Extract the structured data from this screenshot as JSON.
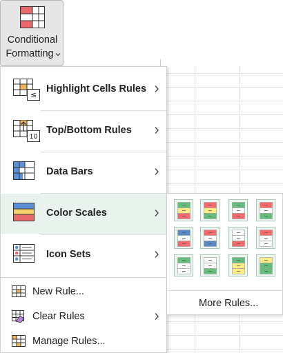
{
  "ribbon": {
    "cf_label_line1": "Conditional",
    "cf_label_line2": "Formatting"
  },
  "menu": {
    "items": [
      {
        "label": "Highlight Cells Rules",
        "icon": "highlight-cells-icon",
        "has_submenu": true
      },
      {
        "label": "Top/Bottom Rules",
        "icon": "top-bottom-icon",
        "icon_text": "10",
        "has_submenu": true
      },
      {
        "label": "Data Bars",
        "icon": "data-bars-icon",
        "has_submenu": true
      },
      {
        "label": "Color Scales",
        "icon": "color-scales-icon",
        "has_submenu": true,
        "active": true
      },
      {
        "label": "Icon Sets",
        "icon": "icon-sets-icon",
        "has_submenu": true
      }
    ],
    "small_items": [
      {
        "label": "New Rule...",
        "icon": "new-rule-icon"
      },
      {
        "label": "Clear Rules",
        "icon": "clear-rules-icon",
        "has_submenu": true
      },
      {
        "label": "Manage Rules...",
        "icon": "manage-rules-icon"
      }
    ]
  },
  "submenu": {
    "scales": [
      {
        "top": "#63be7b",
        "mid": "#ffeb84",
        "bot": "#f8696b"
      },
      {
        "top": "#f8696b",
        "mid": "#ffeb84",
        "bot": "#63be7b"
      },
      {
        "top": "#63be7b",
        "mid": "#fcfcff",
        "bot": "#f8696b"
      },
      {
        "top": "#f8696b",
        "mid": "#fcfcff",
        "bot": "#63be7b"
      },
      {
        "top": "#5a8ac6",
        "mid": "#fcfcff",
        "bot": "#f8696b"
      },
      {
        "top": "#f8696b",
        "mid": "#fcfcff",
        "bot": "#5a8ac6"
      },
      {
        "top": "#fcfcff",
        "mid": "#fcfcff",
        "bot": "#f8696b"
      },
      {
        "top": "#f8696b",
        "mid": "#fcfcff",
        "bot": "#fcfcff"
      },
      {
        "top": "#63be7b",
        "mid": "#fcfcff",
        "bot": "#fcfcff"
      },
      {
        "top": "#fcfcff",
        "mid": "#fcfcff",
        "bot": "#63be7b"
      },
      {
        "top": "#63be7b",
        "mid": "#ffeb84",
        "bot": "#ffeb84"
      },
      {
        "top": "#ffeb84",
        "mid": "#63be7b",
        "bot": "#63be7b"
      }
    ],
    "more_rules_label": "More Rules..."
  },
  "colors": {
    "accent_green": "#1e7145",
    "active_bg": "#e9f3ee",
    "orange": "#f2b35a",
    "red": "#e8696b",
    "blue": "#5b8fd6"
  }
}
